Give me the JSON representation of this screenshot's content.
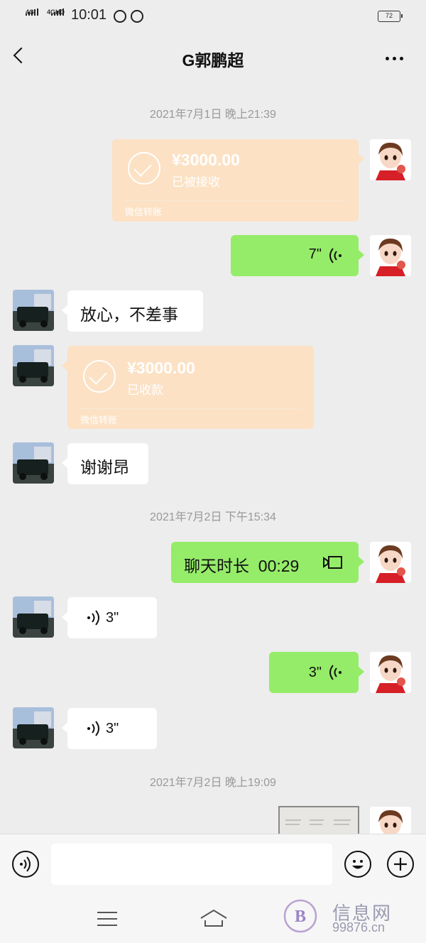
{
  "status_bar": {
    "net1": "4G",
    "net2": "4GHD",
    "time": "10:01",
    "battery": "72"
  },
  "header": {
    "title": "G郭鹏超"
  },
  "messages": {
    "ts1": "2021年7月1日  晚上21:39",
    "t1_amount": "¥3000.00",
    "t1_status": "已被接收",
    "t1_footer": "微信转账",
    "voice1": "7\"",
    "text1": "放心，不差事",
    "t2_amount": "¥3000.00",
    "t2_status": "已收款",
    "t2_footer": "微信转账",
    "text2": "谢谢昂",
    "ts2": "2021年7月2日  下午15:34",
    "call": "聊天时长  00:29",
    "voice2": "3\"",
    "voice3": "3\"",
    "voice4": "3\"",
    "ts3": "2021年7月2日  晚上19:09"
  },
  "watermark": {
    "text": "信息网",
    "url": "99876.cn"
  },
  "colors": {
    "bg": "#ededed",
    "green_bubble": "#95ec69",
    "transfer": "#fce1c4"
  }
}
